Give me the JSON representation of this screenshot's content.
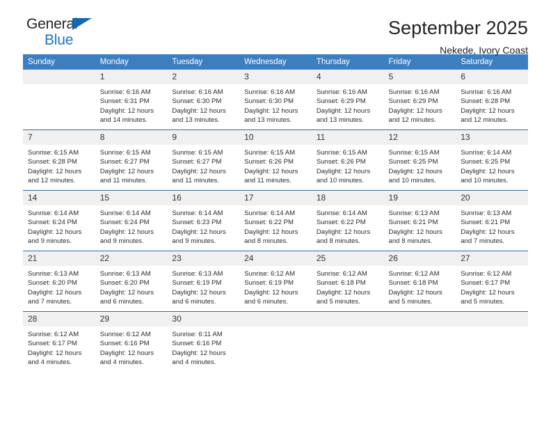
{
  "brand": {
    "line1": "General",
    "line2": "Blue",
    "triangle_color": "#1266b3",
    "text_color": "#231f20",
    "blue_color": "#1874c4"
  },
  "header": {
    "title": "September 2025",
    "subtitle": "Nekede, Ivory Coast"
  },
  "theme": {
    "header_bg": "#3c7fc1",
    "week_border": "#2e6da4",
    "daynum_bg": "#f0f0f0"
  },
  "weekdays": [
    "Sunday",
    "Monday",
    "Tuesday",
    "Wednesday",
    "Thursday",
    "Friday",
    "Saturday"
  ],
  "weeks": [
    [
      {
        "day": "",
        "empty": true,
        "sunrise": "",
        "sunset": "",
        "daylight": ""
      },
      {
        "day": "1",
        "sunrise": "Sunrise: 6:16 AM",
        "sunset": "Sunset: 6:31 PM",
        "daylight": "Daylight: 12 hours and 14 minutes."
      },
      {
        "day": "2",
        "sunrise": "Sunrise: 6:16 AM",
        "sunset": "Sunset: 6:30 PM",
        "daylight": "Daylight: 12 hours and 13 minutes."
      },
      {
        "day": "3",
        "sunrise": "Sunrise: 6:16 AM",
        "sunset": "Sunset: 6:30 PM",
        "daylight": "Daylight: 12 hours and 13 minutes."
      },
      {
        "day": "4",
        "sunrise": "Sunrise: 6:16 AM",
        "sunset": "Sunset: 6:29 PM",
        "daylight": "Daylight: 12 hours and 13 minutes."
      },
      {
        "day": "5",
        "sunrise": "Sunrise: 6:16 AM",
        "sunset": "Sunset: 6:29 PM",
        "daylight": "Daylight: 12 hours and 12 minutes."
      },
      {
        "day": "6",
        "sunrise": "Sunrise: 6:16 AM",
        "sunset": "Sunset: 6:28 PM",
        "daylight": "Daylight: 12 hours and 12 minutes."
      }
    ],
    [
      {
        "day": "7",
        "sunrise": "Sunrise: 6:15 AM",
        "sunset": "Sunset: 6:28 PM",
        "daylight": "Daylight: 12 hours and 12 minutes."
      },
      {
        "day": "8",
        "sunrise": "Sunrise: 6:15 AM",
        "sunset": "Sunset: 6:27 PM",
        "daylight": "Daylight: 12 hours and 11 minutes."
      },
      {
        "day": "9",
        "sunrise": "Sunrise: 6:15 AM",
        "sunset": "Sunset: 6:27 PM",
        "daylight": "Daylight: 12 hours and 11 minutes."
      },
      {
        "day": "10",
        "sunrise": "Sunrise: 6:15 AM",
        "sunset": "Sunset: 6:26 PM",
        "daylight": "Daylight: 12 hours and 11 minutes."
      },
      {
        "day": "11",
        "sunrise": "Sunrise: 6:15 AM",
        "sunset": "Sunset: 6:26 PM",
        "daylight": "Daylight: 12 hours and 10 minutes."
      },
      {
        "day": "12",
        "sunrise": "Sunrise: 6:15 AM",
        "sunset": "Sunset: 6:25 PM",
        "daylight": "Daylight: 12 hours and 10 minutes."
      },
      {
        "day": "13",
        "sunrise": "Sunrise: 6:14 AM",
        "sunset": "Sunset: 6:25 PM",
        "daylight": "Daylight: 12 hours and 10 minutes."
      }
    ],
    [
      {
        "day": "14",
        "sunrise": "Sunrise: 6:14 AM",
        "sunset": "Sunset: 6:24 PM",
        "daylight": "Daylight: 12 hours and 9 minutes."
      },
      {
        "day": "15",
        "sunrise": "Sunrise: 6:14 AM",
        "sunset": "Sunset: 6:24 PM",
        "daylight": "Daylight: 12 hours and 9 minutes."
      },
      {
        "day": "16",
        "sunrise": "Sunrise: 6:14 AM",
        "sunset": "Sunset: 6:23 PM",
        "daylight": "Daylight: 12 hours and 9 minutes."
      },
      {
        "day": "17",
        "sunrise": "Sunrise: 6:14 AM",
        "sunset": "Sunset: 6:22 PM",
        "daylight": "Daylight: 12 hours and 8 minutes."
      },
      {
        "day": "18",
        "sunrise": "Sunrise: 6:14 AM",
        "sunset": "Sunset: 6:22 PM",
        "daylight": "Daylight: 12 hours and 8 minutes."
      },
      {
        "day": "19",
        "sunrise": "Sunrise: 6:13 AM",
        "sunset": "Sunset: 6:21 PM",
        "daylight": "Daylight: 12 hours and 8 minutes."
      },
      {
        "day": "20",
        "sunrise": "Sunrise: 6:13 AM",
        "sunset": "Sunset: 6:21 PM",
        "daylight": "Daylight: 12 hours and 7 minutes."
      }
    ],
    [
      {
        "day": "21",
        "sunrise": "Sunrise: 6:13 AM",
        "sunset": "Sunset: 6:20 PM",
        "daylight": "Daylight: 12 hours and 7 minutes."
      },
      {
        "day": "22",
        "sunrise": "Sunrise: 6:13 AM",
        "sunset": "Sunset: 6:20 PM",
        "daylight": "Daylight: 12 hours and 6 minutes."
      },
      {
        "day": "23",
        "sunrise": "Sunrise: 6:13 AM",
        "sunset": "Sunset: 6:19 PM",
        "daylight": "Daylight: 12 hours and 6 minutes."
      },
      {
        "day": "24",
        "sunrise": "Sunrise: 6:12 AM",
        "sunset": "Sunset: 6:19 PM",
        "daylight": "Daylight: 12 hours and 6 minutes."
      },
      {
        "day": "25",
        "sunrise": "Sunrise: 6:12 AM",
        "sunset": "Sunset: 6:18 PM",
        "daylight": "Daylight: 12 hours and 5 minutes."
      },
      {
        "day": "26",
        "sunrise": "Sunrise: 6:12 AM",
        "sunset": "Sunset: 6:18 PM",
        "daylight": "Daylight: 12 hours and 5 minutes."
      },
      {
        "day": "27",
        "sunrise": "Sunrise: 6:12 AM",
        "sunset": "Sunset: 6:17 PM",
        "daylight": "Daylight: 12 hours and 5 minutes."
      }
    ],
    [
      {
        "day": "28",
        "sunrise": "Sunrise: 6:12 AM",
        "sunset": "Sunset: 6:17 PM",
        "daylight": "Daylight: 12 hours and 4 minutes."
      },
      {
        "day": "29",
        "sunrise": "Sunrise: 6:12 AM",
        "sunset": "Sunset: 6:16 PM",
        "daylight": "Daylight: 12 hours and 4 minutes."
      },
      {
        "day": "30",
        "sunrise": "Sunrise: 6:11 AM",
        "sunset": "Sunset: 6:16 PM",
        "daylight": "Daylight: 12 hours and 4 minutes."
      },
      {
        "day": "",
        "empty": true,
        "sunrise": "",
        "sunset": "",
        "daylight": ""
      },
      {
        "day": "",
        "empty": true,
        "sunrise": "",
        "sunset": "",
        "daylight": ""
      },
      {
        "day": "",
        "empty": true,
        "sunrise": "",
        "sunset": "",
        "daylight": ""
      },
      {
        "day": "",
        "empty": true,
        "sunrise": "",
        "sunset": "",
        "daylight": ""
      }
    ]
  ]
}
